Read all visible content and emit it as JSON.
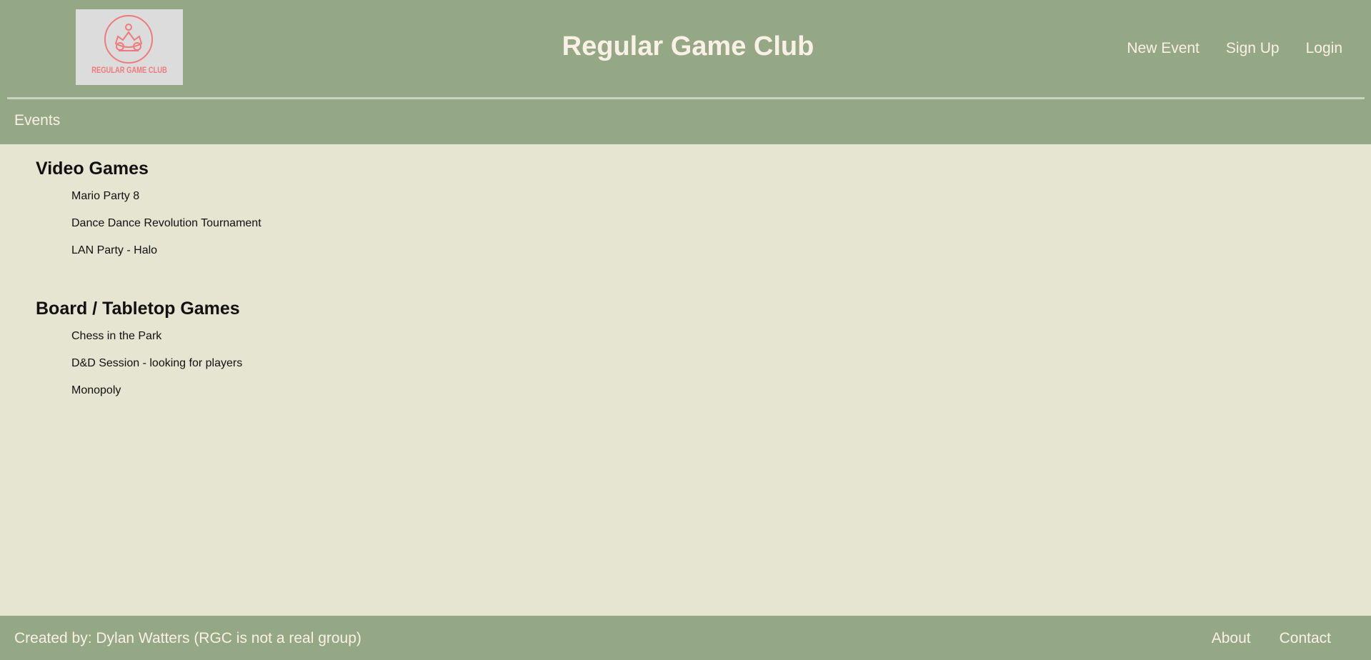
{
  "header": {
    "logo_text": "REGULAR GAME CLUB",
    "site_title": "Regular Game Club",
    "nav": [
      {
        "label": "New Event"
      },
      {
        "label": "Sign Up"
      },
      {
        "label": "Login"
      }
    ]
  },
  "subnav": {
    "label": "Events"
  },
  "sections": [
    {
      "title": "Video Games",
      "events": [
        "Mario Party 8",
        "Dance Dance Revolution Tournament",
        "LAN Party - Halo"
      ]
    },
    {
      "title": "Board / Tabletop Games",
      "events": [
        "Chess in the Park",
        "D&D Session - looking for players",
        "Monopoly"
      ]
    }
  ],
  "footer": {
    "credit": "Created by: Dylan Watters (RGC is not a real group)",
    "nav": [
      {
        "label": "About"
      },
      {
        "label": "Contact"
      }
    ]
  },
  "colors": {
    "header_bg": "#95a886",
    "page_bg": "#e5e5d1",
    "header_text": "#fbf0e6",
    "logo_accent": "#f07a7a"
  }
}
